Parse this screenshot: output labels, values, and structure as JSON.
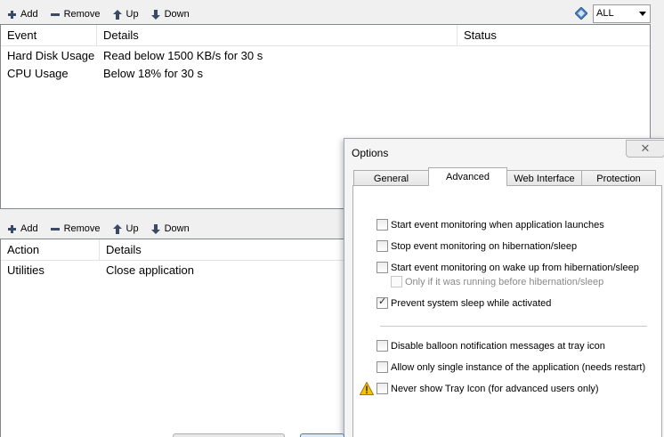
{
  "top_toolbar": {
    "add": "Add",
    "remove": "Remove",
    "up": "Up",
    "down": "Down"
  },
  "filter": {
    "value": "ALL"
  },
  "events_grid": {
    "columns": [
      "Event",
      "Details",
      "Status"
    ],
    "rows": [
      [
        "Hard Disk Usage",
        "Read below 1500 KB/s for 30 s",
        ""
      ],
      [
        "CPU Usage",
        "Below 18% for 30 s",
        ""
      ]
    ]
  },
  "bottom_toolbar": {
    "add": "Add",
    "remove": "Remove",
    "up": "Up",
    "down": "Down"
  },
  "actions_grid": {
    "columns": [
      "Action",
      "Details"
    ],
    "rows": [
      [
        "Utilities",
        "Close application"
      ]
    ]
  },
  "dialog": {
    "title": "Options",
    "close_glyph": "✕",
    "tabs": [
      "General",
      "Advanced",
      "Web Interface",
      "Protection"
    ],
    "options": [
      {
        "label": "Start event monitoring when application launches",
        "checked": false
      },
      {
        "label": "Stop event monitoring on hibernation/sleep",
        "checked": false
      },
      {
        "label": "Start event monitoring on wake up from hibernation/sleep",
        "checked": false
      },
      {
        "label": "Only if it was running before hibernation/sleep",
        "checked": false
      },
      {
        "label": "Prevent system sleep while activated",
        "checked": true
      },
      {
        "label": "Disable balloon notification messages at tray icon",
        "checked": false
      },
      {
        "label": "Allow only single instance of the application (needs restart)",
        "checked": false
      },
      {
        "label": "Never show Tray Icon (for advanced users only)",
        "checked": false
      }
    ]
  },
  "icons": {
    "add": "plus-icon",
    "remove": "minus-icon",
    "up": "arrow-up-icon",
    "down": "arrow-down-icon",
    "filter": "diamond-filter-icon",
    "warning": "warning-icon"
  }
}
